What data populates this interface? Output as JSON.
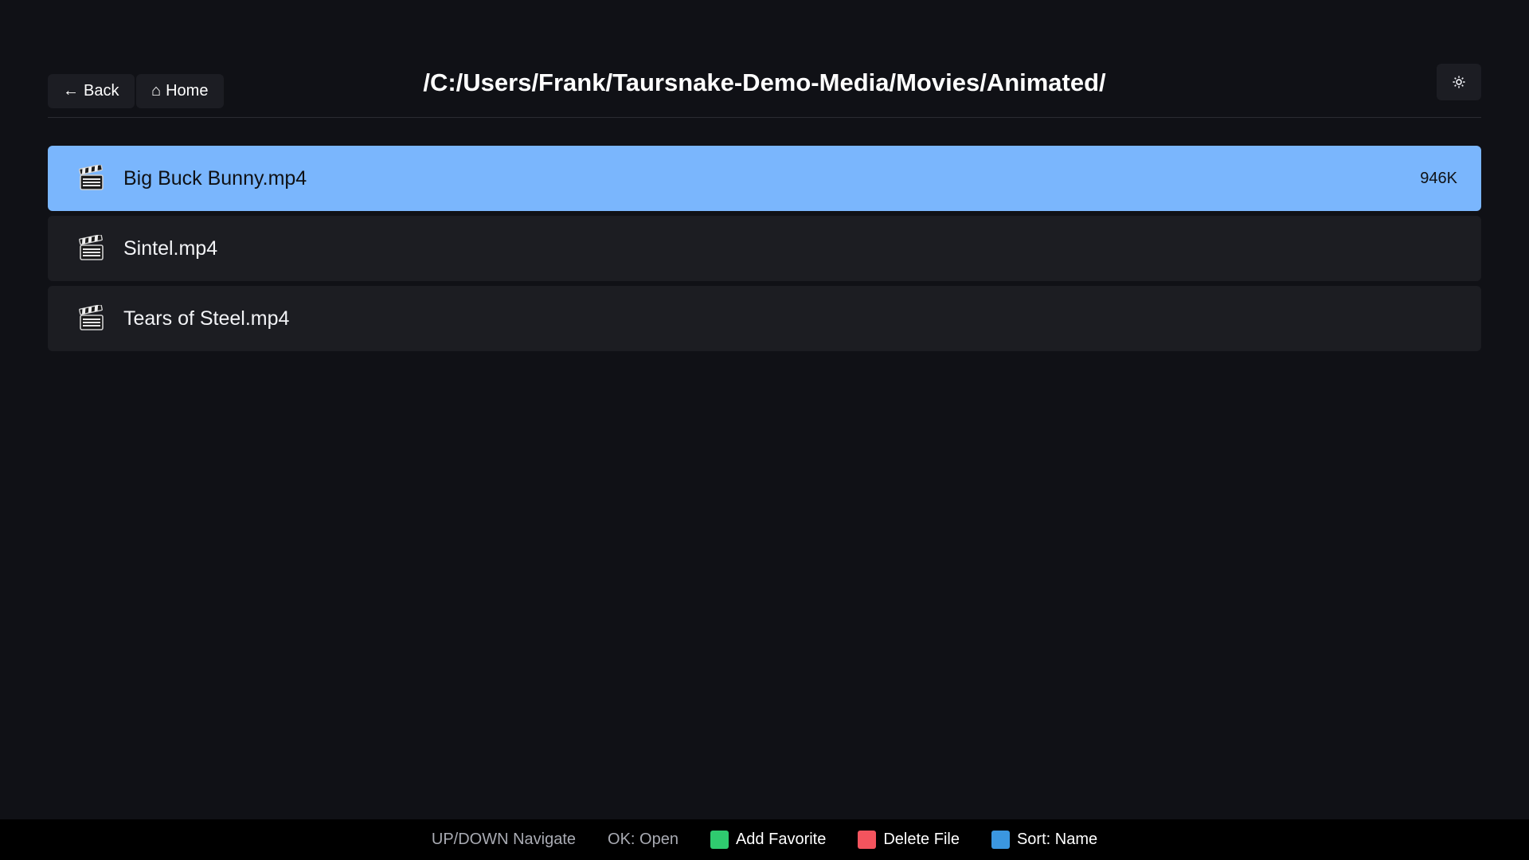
{
  "header": {
    "back_label": "Back",
    "home_label": "Home",
    "path": "/C:/Users/Frank/Taursnake-Demo-Media/Movies/Animated/",
    "icons": {
      "back": "left-arrow-icon",
      "home": "home-icon",
      "settings": "gear-icon"
    }
  },
  "files": [
    {
      "name": "Big Buck Bunny.mp4",
      "size": "946K",
      "selected": true,
      "icon": "clapperboard-icon"
    },
    {
      "name": "Sintel.mp4",
      "size": "",
      "selected": false,
      "icon": "clapperboard-icon"
    },
    {
      "name": "Tears of Steel.mp4",
      "size": "",
      "selected": false,
      "icon": "clapperboard-icon"
    }
  ],
  "footer": {
    "navigate_hint": "UP/DOWN Navigate",
    "ok_hint": "OK: Open",
    "green_label": "Add Favorite",
    "red_label": "Delete File",
    "blue_label": "Sort: Name"
  },
  "colors": {
    "background": "#101116",
    "selected_row": "#7ab6fd",
    "row": "#1c1d22",
    "green_key": "#2fcb6f",
    "red_key": "#f3545e",
    "blue_key": "#3b97e0"
  }
}
